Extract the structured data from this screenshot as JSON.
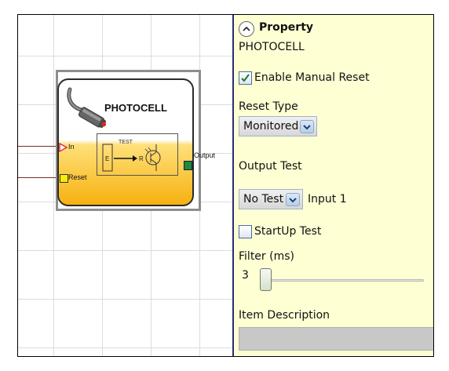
{
  "canvas": {
    "block": {
      "title": "PHOTOCELL",
      "inner_label": "TEST",
      "emitter_label": "E",
      "receiver_label": "R",
      "inputs": [
        {
          "label": "In"
        },
        {
          "label": "Reset"
        }
      ],
      "output_label": "Output"
    }
  },
  "property": {
    "header": "Property",
    "component": "PHOTOCELL",
    "enable_manual_reset": {
      "label": "Enable Manual Reset",
      "checked": true
    },
    "reset_type": {
      "label": "Reset Type",
      "value": "Monitored"
    },
    "output_test": {
      "label": "Output Test",
      "value": "No Test",
      "input_label": "Input 1"
    },
    "startup_test": {
      "label": "StartUp Test",
      "checked": false
    },
    "filter": {
      "label": "Filter (ms)",
      "value": "3"
    },
    "item_description": {
      "label": "Item Description",
      "value": ""
    }
  },
  "colors": {
    "panel_bg": "#ffffd4",
    "block_orange": "#f6b10f",
    "output_pin": "#1f8a3a",
    "reset_pin": "#f5f000",
    "in_pin": "#e0303a"
  }
}
